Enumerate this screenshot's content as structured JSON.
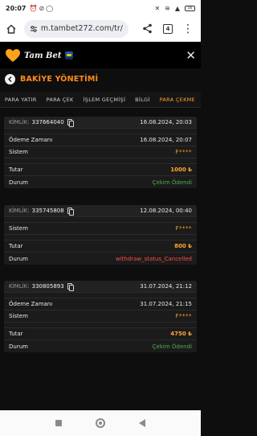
{
  "status_bar": {
    "time": "20:07",
    "battery": "56"
  },
  "browser": {
    "url": "m.tambet272.com/tr/",
    "tab_count": "4"
  },
  "site": {
    "logo_text": "Tam Bet"
  },
  "page": {
    "title": "BAKİYE YÖNETİMİ"
  },
  "tabs": [
    {
      "label": "PARA YATIR"
    },
    {
      "label": "PARA ÇEK"
    },
    {
      "label": "İŞLEM GEÇMİŞİ"
    },
    {
      "label": "BİLGİ"
    },
    {
      "label": "PARA ÇEKME"
    }
  ],
  "labels": {
    "id": "KİMLİK:",
    "payment_time": "Ödeme Zamanı",
    "system": "Sistem",
    "amount": "Tutar",
    "status": "Durum"
  },
  "transactions": [
    {
      "id": "337664040",
      "date": "16.08.2024, 20:03",
      "payment_time": "16.08.2024, 20:07",
      "system": "F****",
      "amount": "1000 ₺",
      "status": "Çekim Ödendi"
    },
    {
      "id": "335745808",
      "date": "12.08.2024, 00:40",
      "system": "F****",
      "amount": "800 ₺",
      "status": "withdraw_status_Cancelled"
    },
    {
      "id": "330805893",
      "date": "31.07.2024, 21:12",
      "payment_time": "31.07.2024, 21:15",
      "system": "F****",
      "amount": "4750 ₺",
      "status": "Çekim Ödendi"
    }
  ]
}
